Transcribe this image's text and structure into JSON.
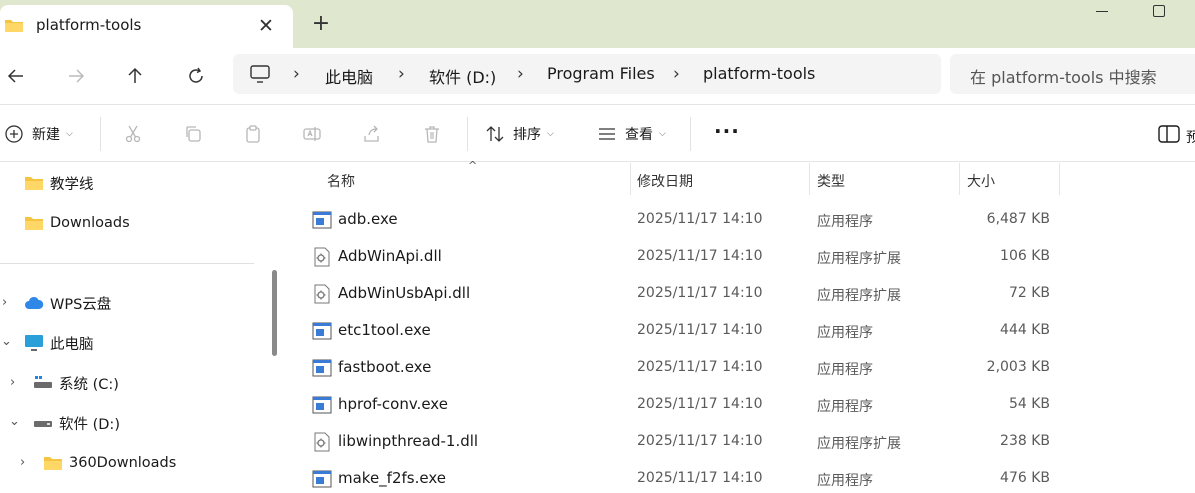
{
  "tab": {
    "title": "platform-tools"
  },
  "address": {
    "crumbs": [
      "此电脑",
      "软件 (D:)",
      "Program Files",
      "platform-tools"
    ]
  },
  "search": {
    "placeholder": "在 platform-tools 中搜索"
  },
  "toolbar": {
    "new_label": "新建",
    "sort_label": "排序",
    "view_label": "查看",
    "details_label": "预"
  },
  "sidebar": {
    "items": [
      {
        "label": "教学线",
        "icon": "folder-icon"
      },
      {
        "label": "Downloads",
        "icon": "folder-icon"
      },
      {
        "label": "WPS云盘",
        "icon": "cloud-icon"
      },
      {
        "label": "此电脑",
        "icon": "computer-icon"
      },
      {
        "label": "系统 (C:)",
        "icon": "windows-drive-icon"
      },
      {
        "label": "软件 (D:)",
        "icon": "drive-icon"
      },
      {
        "label": "360Downloads",
        "icon": "folder-icon"
      }
    ]
  },
  "columns": {
    "name": "名称",
    "date": "修改日期",
    "type": "类型",
    "size": "大小"
  },
  "files": [
    {
      "name": "adb.exe",
      "date": "2025/11/17 14:10",
      "type": "应用程序",
      "size": "6,487 KB",
      "icon": "exe-icon"
    },
    {
      "name": "AdbWinApi.dll",
      "date": "2025/11/17 14:10",
      "type": "应用程序扩展",
      "size": "106 KB",
      "icon": "dll-icon"
    },
    {
      "name": "AdbWinUsbApi.dll",
      "date": "2025/11/17 14:10",
      "type": "应用程序扩展",
      "size": "72 KB",
      "icon": "dll-icon"
    },
    {
      "name": "etc1tool.exe",
      "date": "2025/11/17 14:10",
      "type": "应用程序",
      "size": "444 KB",
      "icon": "exe-icon"
    },
    {
      "name": "fastboot.exe",
      "date": "2025/11/17 14:10",
      "type": "应用程序",
      "size": "2,003 KB",
      "icon": "exe-icon"
    },
    {
      "name": "hprof-conv.exe",
      "date": "2025/11/17 14:10",
      "type": "应用程序",
      "size": "54 KB",
      "icon": "exe-icon"
    },
    {
      "name": "libwinpthread-1.dll",
      "date": "2025/11/17 14:10",
      "type": "应用程序扩展",
      "size": "238 KB",
      "icon": "dll-icon"
    },
    {
      "name": "make_f2fs.exe",
      "date": "2025/11/17 14:10",
      "type": "应用程序",
      "size": "476 KB",
      "icon": "exe-icon"
    }
  ],
  "colors": {
    "folder": "#f4c542",
    "accent": "#1a73c8",
    "titlebar": "#dfe8cf"
  }
}
